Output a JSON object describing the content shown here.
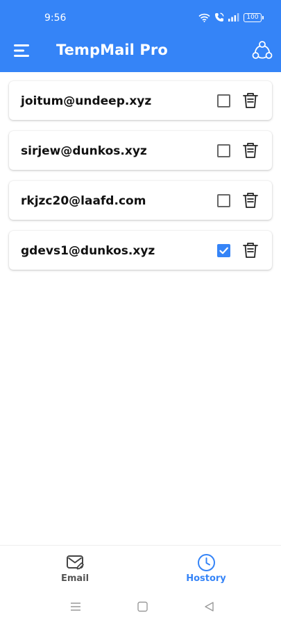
{
  "status": {
    "time": "9:56",
    "battery": "100"
  },
  "app": {
    "title": "TempMail Pro"
  },
  "emails": [
    {
      "address": "joitum@undeep.xyz",
      "checked": false
    },
    {
      "address": "sirjew@dunkos.xyz",
      "checked": false
    },
    {
      "address": "rkjzc20@laafd.com",
      "checked": false
    },
    {
      "address": "gdevs1@dunkos.xyz",
      "checked": true
    }
  ],
  "bottom_nav": {
    "email_label": "Email",
    "history_label": "Hostory"
  },
  "colors": {
    "accent": "#3584f7",
    "text": "#111111",
    "muted": "#555555"
  }
}
